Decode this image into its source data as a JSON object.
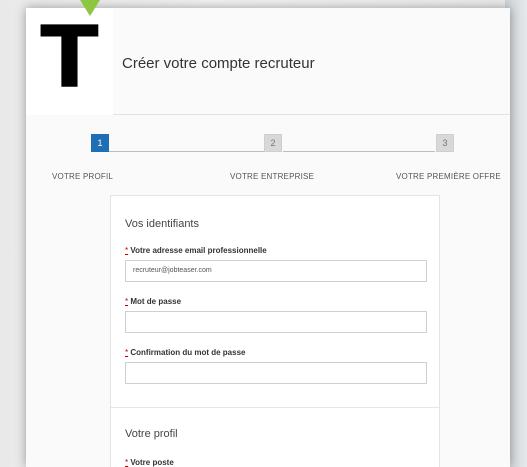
{
  "header": {
    "logo_letter": "T",
    "title": "Créer votre compte recruteur"
  },
  "steps": [
    {
      "number": "1",
      "label": "VOTRE PROFIL",
      "active": true
    },
    {
      "number": "2",
      "label": "VOTRE ENTREPRISE",
      "active": false
    },
    {
      "number": "3",
      "label": "VOTRE PREMIÈRE OFFRE",
      "active": false
    }
  ],
  "form": {
    "section_identifiants": "Vos identifiants",
    "email_label": "Votre adresse email professionnelle",
    "email_value": "recruteur@jobteaser.com",
    "password_label": "Mot de passe",
    "password_value": "",
    "confirm_label": "Confirmation du mot de passe",
    "confirm_value": "",
    "section_profil": "Votre profil",
    "poste_label": "Votre poste",
    "required_mark": "*"
  },
  "colors": {
    "accent": "#1f6fb5",
    "pointer": "#8dc63f"
  }
}
